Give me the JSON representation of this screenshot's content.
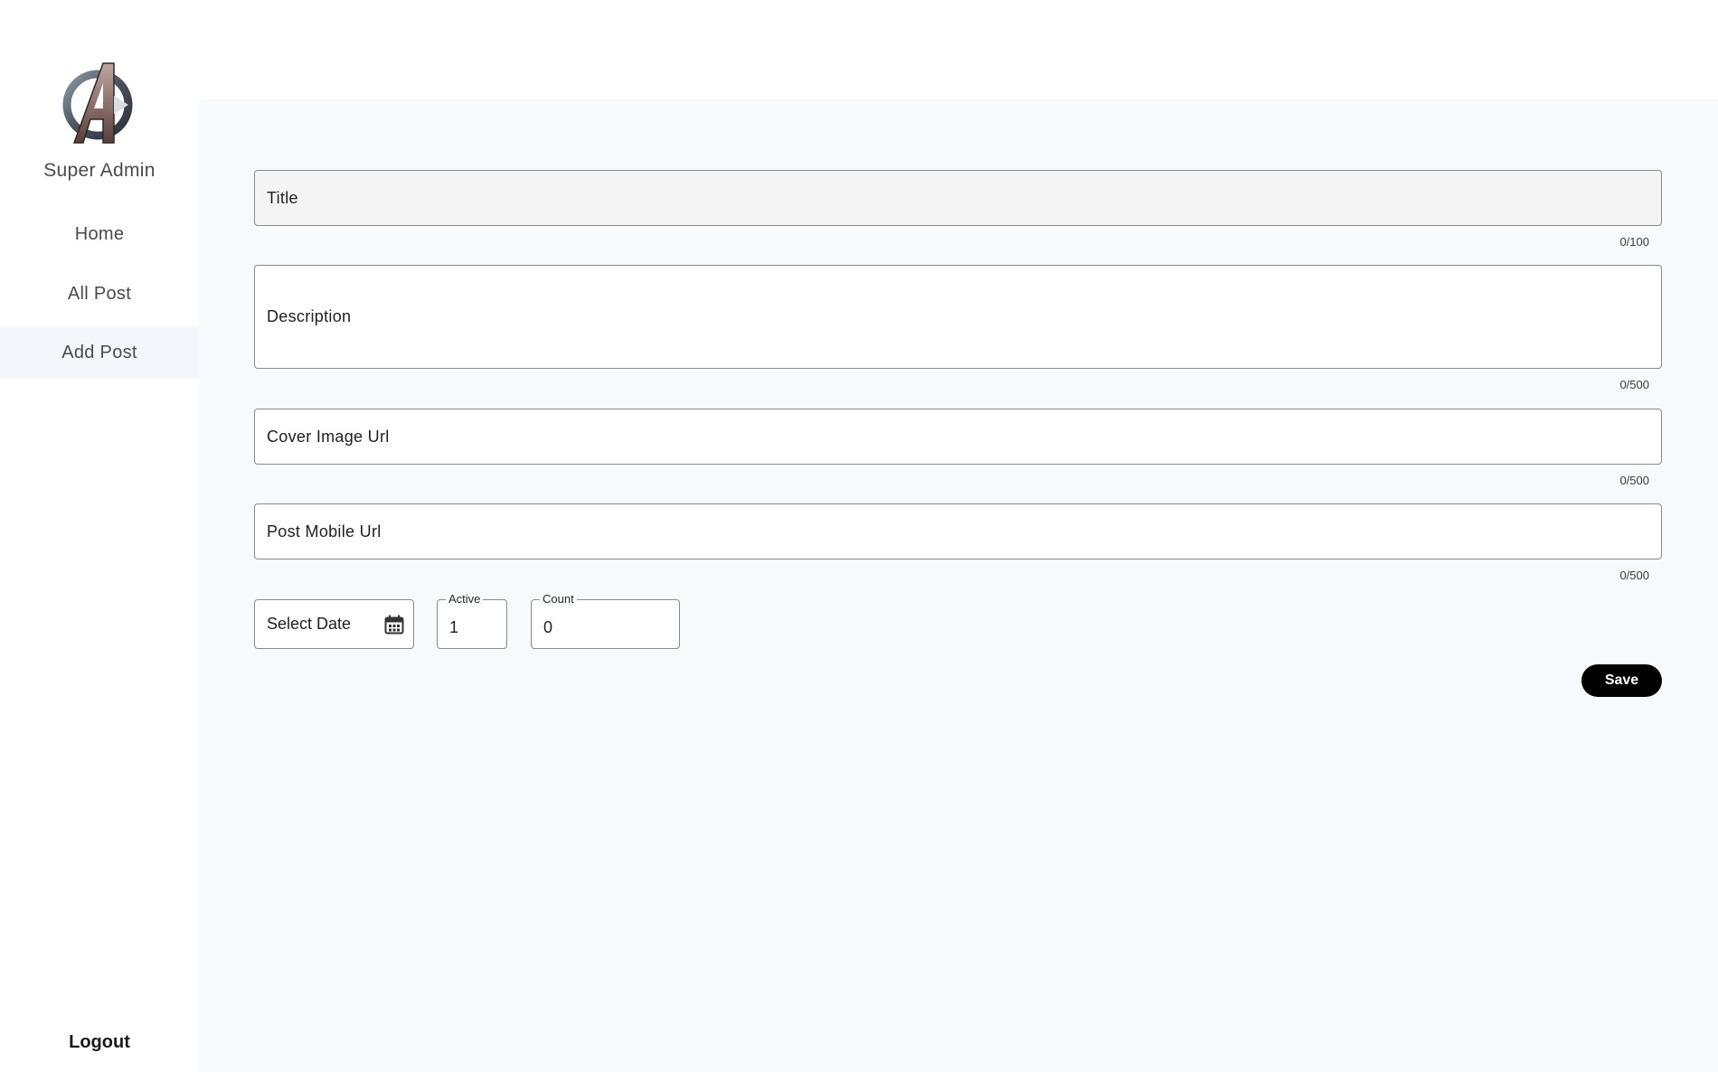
{
  "sidebar": {
    "user_name": "Super Admin",
    "items": [
      {
        "label": "Home"
      },
      {
        "label": "All Post"
      },
      {
        "label": "Add Post"
      }
    ],
    "logout_label": "Logout"
  },
  "form": {
    "title": {
      "label": "Title",
      "counter": "0/100"
    },
    "description": {
      "label": "Description",
      "counter": "0/500"
    },
    "cover_image": {
      "label": "Cover Image Url",
      "counter": "0/500"
    },
    "post_mobile": {
      "label": "Post Mobile Url",
      "counter": "0/500"
    },
    "date": {
      "label": "Select Date"
    },
    "active": {
      "legend": "Active",
      "value": "1"
    },
    "count": {
      "legend": "Count",
      "value": "0"
    },
    "save_label": "Save"
  },
  "icons": {
    "calendar": "calendar-icon",
    "logo": "avengers-logo"
  }
}
